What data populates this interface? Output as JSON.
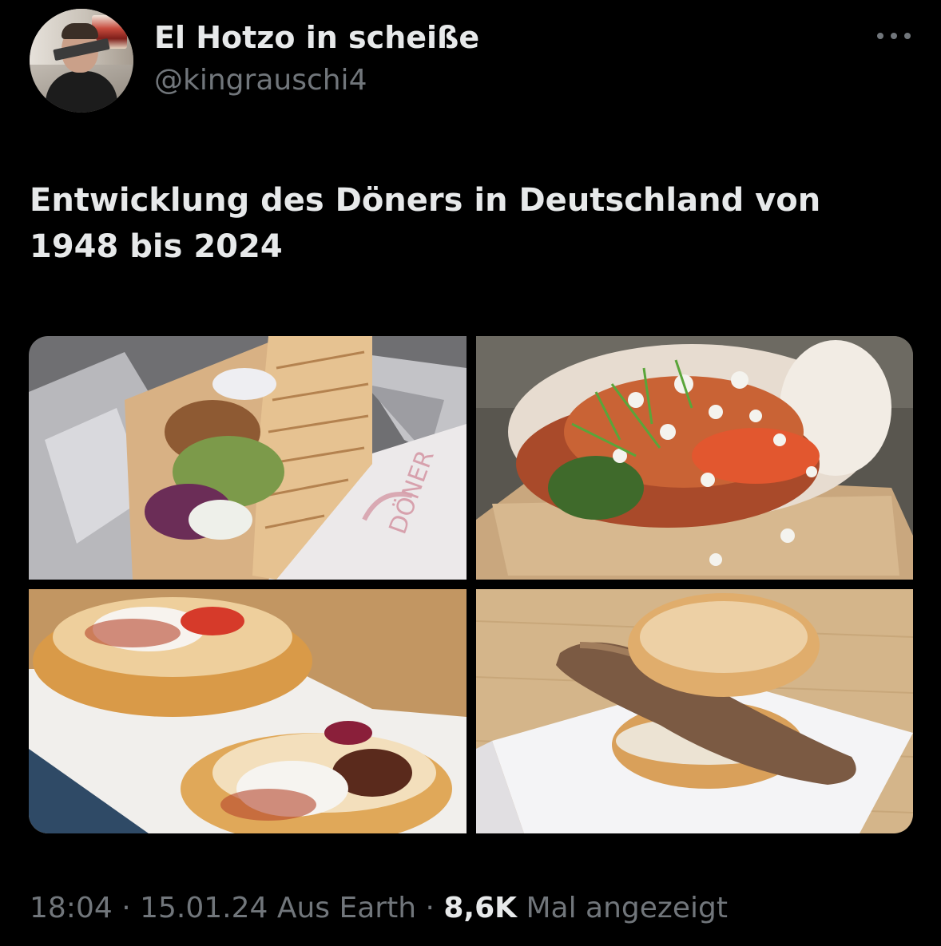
{
  "author": {
    "display_name": "El Hotzo in scheiße",
    "handle": "@kingrauschi4"
  },
  "tweet": {
    "text": "Entwicklung des Döners in Deutschland von 1948 bis 2024"
  },
  "media": [
    {
      "image_text": "DÖNER"
    },
    {
      "image_text": ""
    },
    {
      "image_text": ""
    },
    {
      "image_text": ""
    }
  ],
  "meta": {
    "time": "18:04",
    "sep1": " · ",
    "date": "15.01.24",
    "source": " Aus Earth",
    "sep2": " · ",
    "views": "8,6K",
    "views_label": " Mal angezeigt"
  },
  "icons": {
    "more": "more-horizontal-icon"
  },
  "colors": {
    "background": "#000000",
    "primary_text": "#e7e9ea",
    "secondary_text": "#71767b"
  }
}
